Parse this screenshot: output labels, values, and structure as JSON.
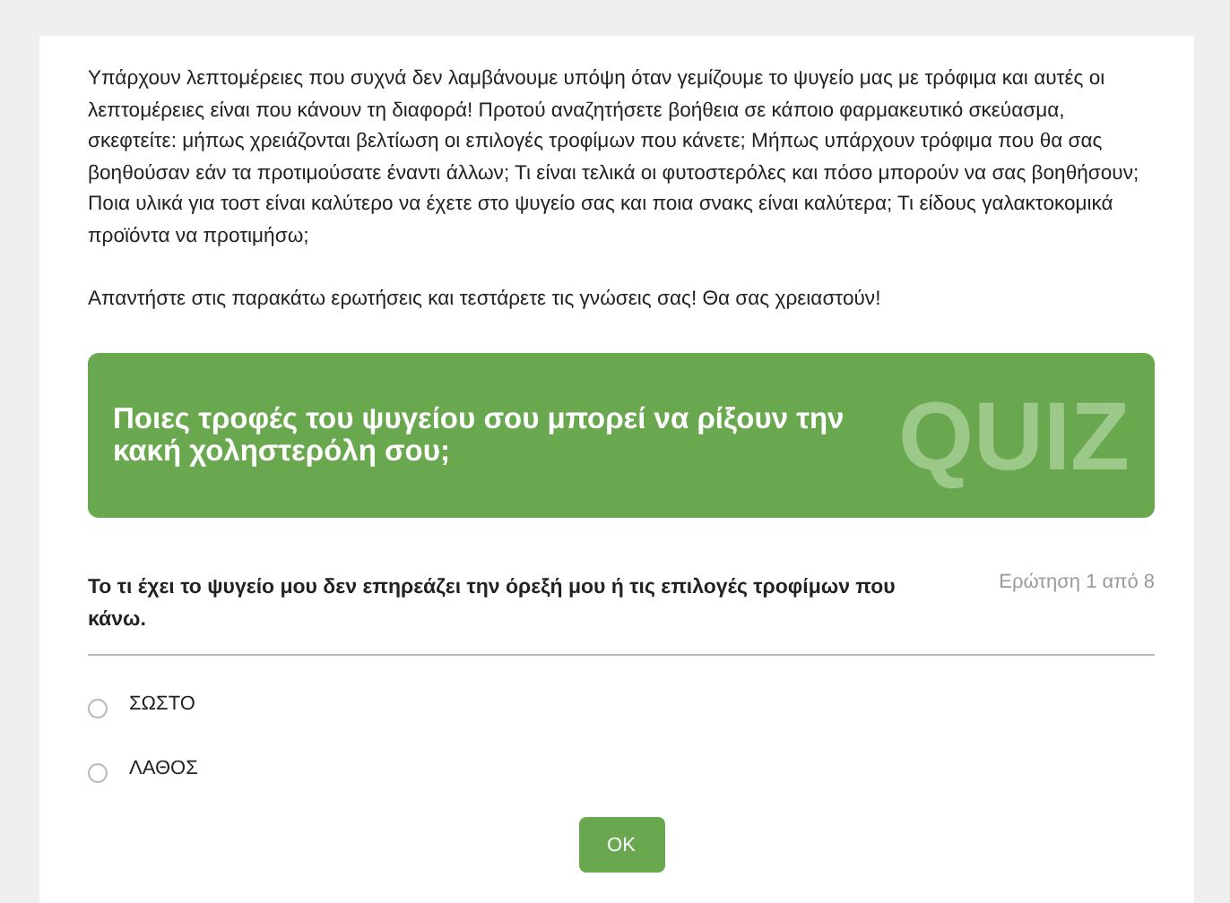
{
  "intro": "Υπάρχουν λεπτομέρειες που συχνά δεν λαμβάνουμε υπόψη όταν γεμίζουμε το ψυγείο μας με τρόφιμα και αυτές οι λεπτομέρειες είναι που κάνουν τη διαφορά! Προτού αναζητήσετε βοήθεια σε κάποιο φαρμακευτικό σκεύασμα, σκεφτείτε: μήπως χρειάζονται βελτίωση οι επιλογές τροφίμων που κάνετε; Μήπως υπάρχουν τρόφιμα που θα σας βοηθούσαν εάν τα προτιμούσατε έναντι άλλων; Τι είναι τελικά οι φυτοστερόλες και πόσο μπορούν να σας βοηθήσουν; Ποια υλικά για τοστ είναι καλύτερο να έχετε στο ψυγείο σας και ποια σνακς είναι καλύτερα; Τι είδους γαλακτοκομικά προϊόντα να προτιμήσω;",
  "call_to_action": "Απαντήστε στις παρακάτω ερωτήσεις και τεστάρετε τις γνώσεις σας! Θα σας χρειαστούν!",
  "banner": {
    "title": "Ποιες τροφές του ψυγείου σου μπορεί να ρίξουν την κακή χοληστερόλη σου;",
    "decoration": "QUIZ"
  },
  "question": {
    "text": "Το τι έχει το ψυγείο μου δεν επηρεάζει την όρεξή μου ή τις επιλογές τροφίμων που κάνω.",
    "counter": "Ερώτηση 1 από 8"
  },
  "options": [
    {
      "label": "ΣΩΣΤΟ",
      "selected": false
    },
    {
      "label": "ΛΑΘΟΣ",
      "selected": false
    }
  ],
  "button": "OK"
}
